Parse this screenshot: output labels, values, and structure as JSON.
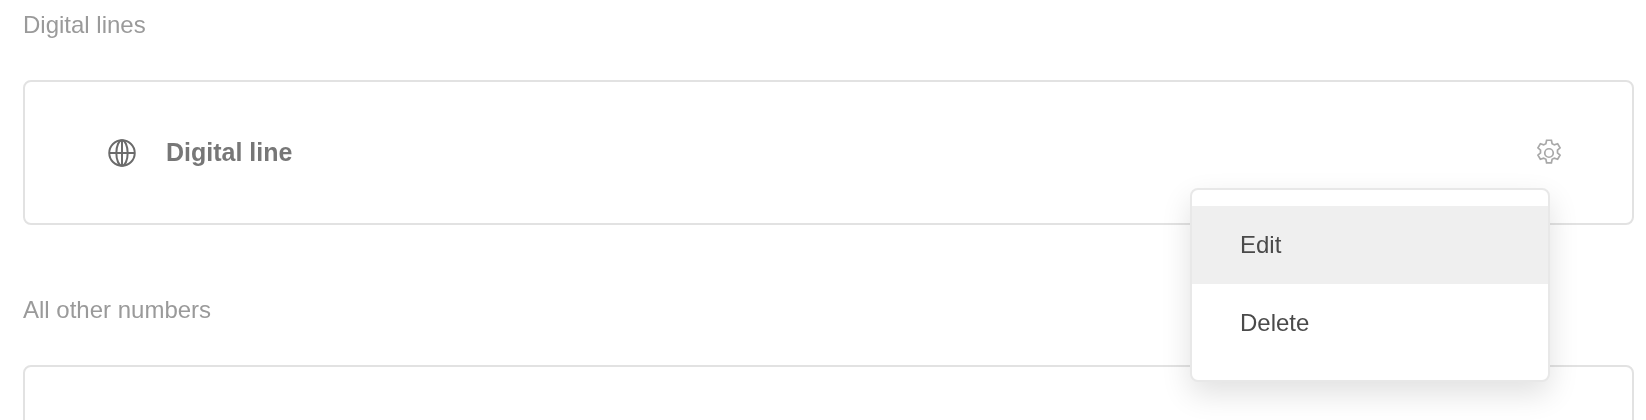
{
  "sections": [
    {
      "heading": "Digital lines",
      "items": [
        {
          "label": "Digital line"
        }
      ]
    },
    {
      "heading": "All other numbers"
    }
  ],
  "menu": {
    "items": [
      {
        "label": "Edit",
        "highlighted": true
      },
      {
        "label": "Delete",
        "highlighted": false
      }
    ]
  }
}
